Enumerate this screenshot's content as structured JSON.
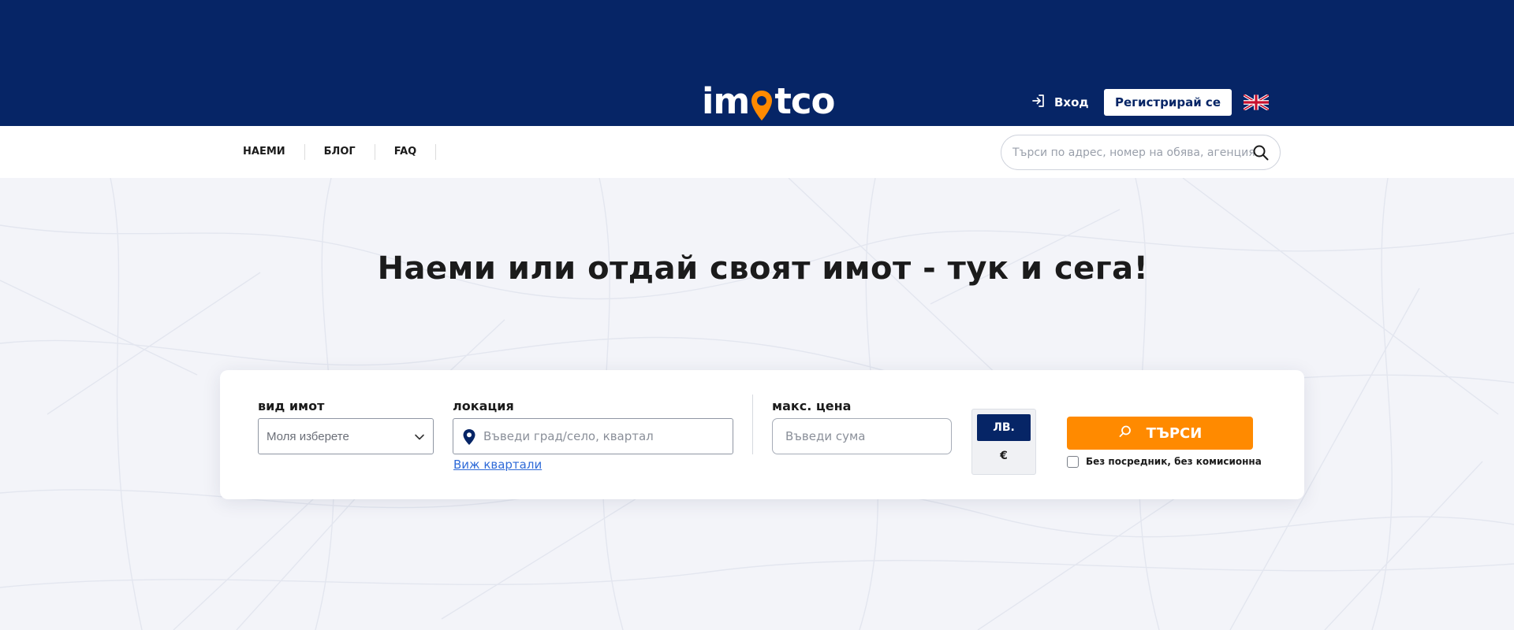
{
  "header": {
    "logo": {
      "part1": "im",
      "part2": "tco"
    },
    "login_label": "Вход",
    "register_label": "Регистрирай се",
    "language_flag": "uk-flag-icon"
  },
  "nav": {
    "items": [
      {
        "label": "НАЕМИ"
      },
      {
        "label": "БЛОГ"
      },
      {
        "label": "FAQ"
      }
    ],
    "search_placeholder": "Търси по адрес, номер на обява, агенция"
  },
  "hero": {
    "title": "Наеми или отдай своят имот - тук и сега!"
  },
  "search_form": {
    "property_type_label": "вид имот",
    "property_type_value": "Моля изберете",
    "location_label": "локация",
    "location_placeholder": "Въведи град/село, квартал",
    "neighborhoods_link": "Виж квартали",
    "max_price_label": "макс. цена",
    "max_price_placeholder": "Въведи сума",
    "currency_options": [
      "ЛВ.",
      "€"
    ],
    "currency_selected": "ЛВ.",
    "search_button": "ТЪРСИ",
    "no_commission_label": "Без посредник, без комисионна"
  },
  "colors": {
    "brand_navy": "#062566",
    "accent_orange": "#ff8a00",
    "link_blue": "#2f6bd8"
  }
}
